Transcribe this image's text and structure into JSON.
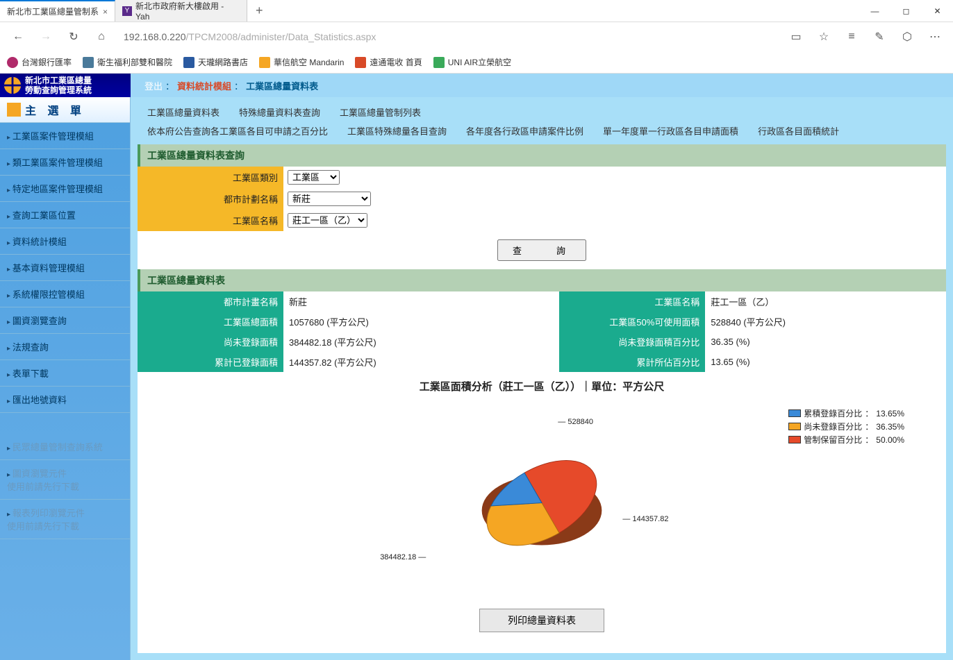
{
  "browser": {
    "tabs": [
      {
        "title": "新北市工業區總量管制系",
        "active": true
      },
      {
        "title": "新北市政府新大樓啟用 - Yah",
        "active": false
      }
    ],
    "url_host": "192.168.0.220",
    "url_path": "/TPCM2008/administer/Data_Statistics.aspx",
    "favs": [
      {
        "label": "台灣銀行匯率",
        "color": "#b02a6a"
      },
      {
        "label": "衛生福利部雙和醫院",
        "color": "#4a7a9a"
      },
      {
        "label": "天瓏網路書店",
        "color": "#2a5aa0"
      },
      {
        "label": "華信航空 Mandarin",
        "color": "#f5a623"
      },
      {
        "label": "遠通電收 首頁",
        "color": "#d84a28"
      },
      {
        "label": "UNI AIR立榮航空",
        "color": "#3aaa5a"
      }
    ]
  },
  "header": {
    "logo_line1": "新北市工業區總量",
    "logo_line2": "勞動查詢管理系統",
    "logout": "登出",
    "module1": "資料統計模組",
    "module2": "工業區總量資料表"
  },
  "sidebar": {
    "title": "主 選 單",
    "items": [
      "工業區案件管理模組",
      "類工業區案件管理模組",
      "特定地區案件管理模組",
      "查詢工業區位置",
      "資料統計模組",
      "基本資料管理模組",
      "系統權限控管模組",
      "圖資瀏覽查詢",
      "法規查詢",
      "表單下載",
      "匯出地號資料"
    ],
    "dim_items": [
      "民眾總量管制查詢系統",
      "圖資瀏覽元件\n使用前請先行下載",
      "報表列印瀏覽元件\n使用前請先行下載"
    ]
  },
  "tabs1": [
    "工業區總量資料表",
    "特殊總量資料表查詢",
    "工業區總量管制列表"
  ],
  "tabs2": [
    "依本府公告查詢各工業區各目可申請之百分比",
    "工業區特殊總量各目查詢",
    "各年度各行政區申請案件比例",
    "單一年度單一行政區各目申請面積",
    "行政區各目面積統計"
  ],
  "query_section": {
    "title": "工業區總量資料表查詢",
    "rows": [
      {
        "label": "工業區類別",
        "value": "工業區"
      },
      {
        "label": "都市計劃名稱",
        "value": "新莊"
      },
      {
        "label": "工業區名稱",
        "value": "莊工一區（乙）"
      }
    ],
    "button": "查　　詢"
  },
  "result_section": {
    "title": "工業區總量資料表",
    "rows": [
      {
        "k1": "都市計畫名稱",
        "v1": "新莊",
        "k2": "工業區名稱",
        "v2": "莊工一區（乙）"
      },
      {
        "k1": "工業區總面積",
        "v1": "1057680 (平方公尺)",
        "k2": "工業區50%可使用面積",
        "v2": "528840 (平方公尺)"
      },
      {
        "k1": "尚未登錄面積",
        "v1": "384482.18 (平方公尺)",
        "k2": "尚未登錄面積百分比",
        "v2": "36.35 (%)"
      },
      {
        "k1": "累計已登錄面積",
        "v1": "144357.82 (平方公尺)",
        "k2": "累計所佔百分比",
        "v2": "13.65 (%)"
      }
    ]
  },
  "chart_data": {
    "type": "pie",
    "title": "工業區面積分析（莊工一區（乙））｜單位：平方公尺",
    "series": [
      {
        "name": "累積登錄百分比",
        "pct": "13.65%",
        "value": 144357.82,
        "color": "#3a8ad8"
      },
      {
        "name": "尚未登錄百分比",
        "pct": "36.35%",
        "value": 384482.18,
        "color": "#f5a623"
      },
      {
        "name": "管制保留百分比",
        "pct": "50.00%",
        "value": 528840,
        "color": "#e64a2a"
      }
    ],
    "callouts": [
      "528840",
      "144357.82",
      "384482.18"
    ]
  },
  "print_button": "列印總量資料表"
}
